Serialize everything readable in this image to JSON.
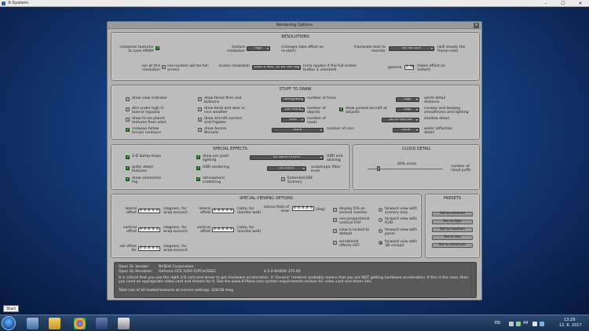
{
  "window": {
    "title": "X-System"
  },
  "dialog": {
    "title": "Rendering Options"
  },
  "resolutions": {
    "header": "RESOLUTIONS",
    "compress_label": "compress textures to save VRAM",
    "texres_label": "texture resolution",
    "texres_value": "high",
    "texres_note": "(changes take effect on re-start)",
    "framerate_label": "framerate-lock to monitor",
    "framerate_value": "do not lock",
    "framerate_note": "(will steady the frame-rate)",
    "runres_label": "run at this resolution",
    "runres_note": "non-system will be full-screen",
    "screenres_label": "screen resolution",
    "screenres_value": "1600 x 900, 32 bit (60 Hz)",
    "screenres_note": "(only applies if the full-screen button is checked)",
    "gamma_label": "gamma",
    "gamma_value": "2.20",
    "gamma_note": "(takes effect on restart)"
  },
  "stuff": {
    "header": "STUFF TO DRAW",
    "view_indicator": "draw view indicator",
    "forest": "draw forest fires and balloons",
    "trees_value": "overgrown",
    "trees_label": "number of trees",
    "world_value": "high",
    "world_label": "world detail distance",
    "dim_label": "dim under high G-load or hypoxia",
    "birds": "draw birds and deer in nice weather",
    "objects_value": "too many",
    "objects_label": "number of objects",
    "parked": "draw parked aircraft at airports",
    "runway_value": "high",
    "runway_label": "runway and taxiway smoothness and lighting",
    "hires": "draw hi-res planet textures from orbit",
    "carriers": "draw aircraft carriers and frigates",
    "roads_value": "tons",
    "roads_label": "number of roads",
    "shadow_value": "3d on aircraft",
    "shadow_label": "shadow detail",
    "runways": "runways follow terrain contours",
    "aurora": "draw Aurora Borealis",
    "cars_value": "none",
    "cars_label": "number of cars",
    "water_value": "none",
    "water_label": "water reflection detail"
  },
  "effects": {
    "header": "SPECIAL EFFECTS",
    "bump": "3-D bump-maps",
    "pixel": "draw per pixel lighting",
    "aa_value": "4x SSAA+FXAA",
    "aa_label": "HDR anti-aliasing",
    "gritty": "gritty detail textures",
    "hdr": "HDR rendering",
    "aniso_value": "2x (nice)",
    "aniso_label": "anisotropic filter level",
    "volfog": "draw volumetric fog",
    "atmos": "atmospheric scattering",
    "dsf": "Extended DSF Scenery"
  },
  "cloud": {
    "header": "CLOUD DETAIL",
    "value": "40% some",
    "label": "number of cloud puffs",
    "level": 0.4
  },
  "viewing": {
    "header": "SPECIAL VIEWING OPTIONS",
    "lat_label": "lateral offset",
    "lat_value": "0 0.0 0 0",
    "lat_note": "(degrees, for wrap-around)",
    "latr_label": "lateral offset",
    "latr_value": "0 0.0 0 0",
    "latr_note": "(ratio, for monitor-wall)",
    "fov_label": "lateral field of view",
    "fov_value": "0 6 0.0 0",
    "fov_note": "(deg)",
    "vert_label": "vertical offset",
    "vert_value": "0 0.0 0 0",
    "vert_note": "(degrees, for wrap-around)",
    "vertr_label": "vertical offset",
    "vertr_value": "0 0.0 0 0",
    "vertr_note": "(ratio, for monitor-wall)",
    "roll_label": "roll offset for",
    "roll_value": "0 0.0 0 0",
    "roll_note": "(degrees, for wrap-around)",
    "ios": "display IOS on second monitor",
    "nonprop": "non-proportional vertical FOV",
    "locked": "view is locked to default",
    "windshield": "windshield effects OFF",
    "fw_only": "forward view with scenery only",
    "fw_hud": "forward view with HUD",
    "fw_panel": "forward view with panel",
    "fw_cockpit": "forward view with 3D cockpit"
  },
  "presets": {
    "header": "PRESETS",
    "items": [
      "Set to extreme",
      "Set to high",
      "Set to medium",
      "Set to low",
      "Set to minimum"
    ]
  },
  "info": {
    "l1a": "Open GL Vendor:",
    "l1b": "NVIDIA Corporation",
    "l2a": "Open GL Renderer:",
    "l2b": "GeForce GTX 1050 Ti/PCIe/SSE2",
    "l2c": "4.5.0 NVIDIA 375.95",
    "msg": "It is critical that you use the right 3-D card and driver to get hardware acceleration. A 'Generic' renderer probably means that you are NOT getting hardware acceleration. If this is the case, then you need an appropriate video card and drivers for it. See the www.X-Plane.com system requirements section for video card and driver info.",
    "total": "Total size of all loaded textures at current settings: 418.58 meg"
  },
  "taskbar": {
    "tooltip": "Start",
    "lang": "EN",
    "volume": "44",
    "time": "13:29",
    "date": "12. 6. 2017"
  }
}
